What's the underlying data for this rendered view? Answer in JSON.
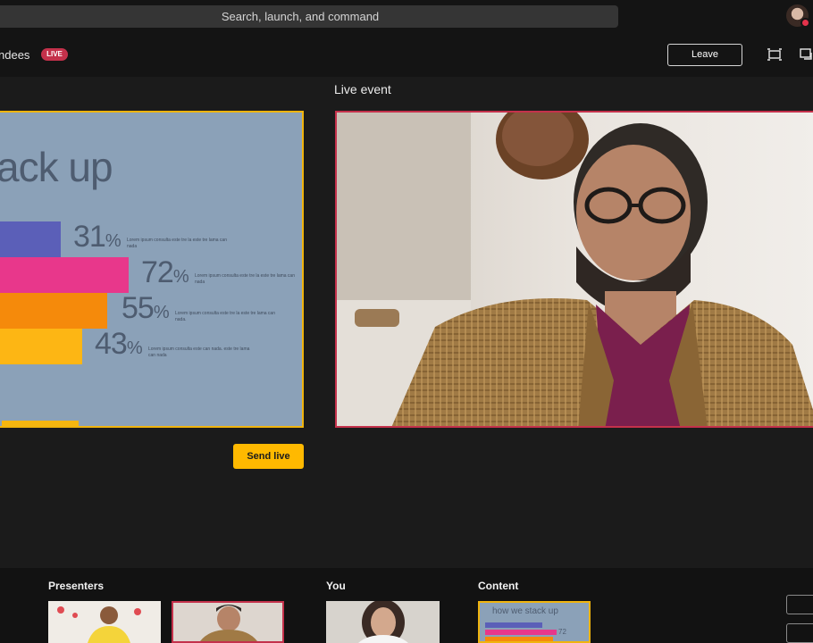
{
  "topbar": {
    "search_placeholder": "Search, launch, and command"
  },
  "header": {
    "event_name": "ndees",
    "live_badge": "LIVE",
    "leave_label": "Leave"
  },
  "queue": {
    "slide": {
      "title": "ack up",
      "bars": [
        {
          "value": "31",
          "unit": "%",
          "color": "#5b5fb8",
          "desc": "Lorem ipsum consulta este tre la este tre lama can nada"
        },
        {
          "value": "72",
          "unit": "%",
          "color": "#e8378b",
          "desc": "Lorem ipsum consulta este tre la este tre lama can nada"
        },
        {
          "value": "55",
          "unit": "%",
          "color": "#f58a0b",
          "desc": "Lorem ipsum consulta este tre la este tre lama can nada."
        },
        {
          "value": "43",
          "unit": "%",
          "color": "#fdb614",
          "desc": "Lorem ipsum consulta este can nada. este tre lama can nada"
        }
      ]
    },
    "send_live_label": "Send live"
  },
  "live": {
    "label": "Live event"
  },
  "strip": {
    "presenters_label": "Presenters",
    "you_label": "You",
    "content_label": "Content",
    "content_slide_title": "how we stack up",
    "content_slide_value": "72"
  },
  "colors": {
    "accent": "#ffb900",
    "live": "#c4314b",
    "queue_border": "#f0b40e"
  }
}
